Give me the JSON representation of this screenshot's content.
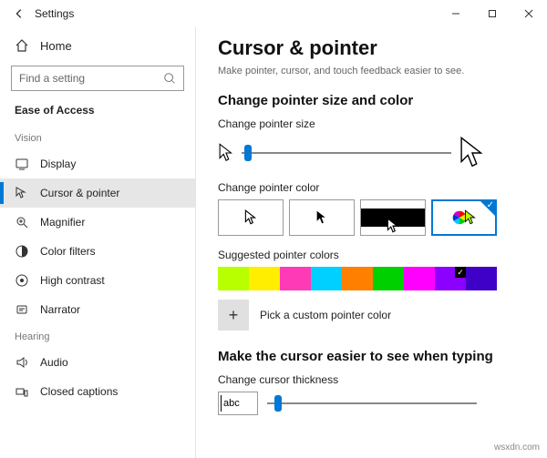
{
  "window": {
    "title": "Settings"
  },
  "sidebar": {
    "home": "Home",
    "search_placeholder": "Find a setting",
    "category": "Ease of Access",
    "groups": {
      "vision": {
        "label": "Vision",
        "items": [
          "Display",
          "Cursor & pointer",
          "Magnifier",
          "Color filters",
          "High contrast",
          "Narrator"
        ],
        "selectedIndex": 1
      },
      "hearing": {
        "label": "Hearing",
        "items": [
          "Audio",
          "Closed captions"
        ]
      }
    }
  },
  "main": {
    "title": "Cursor & pointer",
    "subtitle": "Make pointer, cursor, and touch feedback easier to see.",
    "section_size_color": "Change pointer size and color",
    "label_pointer_size": "Change pointer size",
    "label_pointer_color": "Change pointer color",
    "label_suggested": "Suggested pointer colors",
    "label_pick_custom": "Pick a custom pointer color",
    "section_cursor": "Make the cursor easier to see when typing",
    "label_cursor_thickness": "Change cursor thickness",
    "abc_sample": "abc",
    "pointer_size_value": 1,
    "pointer_color_options": [
      "white",
      "black",
      "inverted",
      "custom"
    ],
    "pointer_color_selected": 3,
    "suggested_colors": [
      "#b8ff00",
      "#ffee00",
      "#ff3ab6",
      "#00d0ff",
      "#ff8000",
      "#00d000",
      "#ff00ff",
      "#8b00ff",
      "#3f00c8"
    ],
    "suggested_selected": 7,
    "cursor_thickness_value": 1
  },
  "watermark": "wsxdn.com"
}
